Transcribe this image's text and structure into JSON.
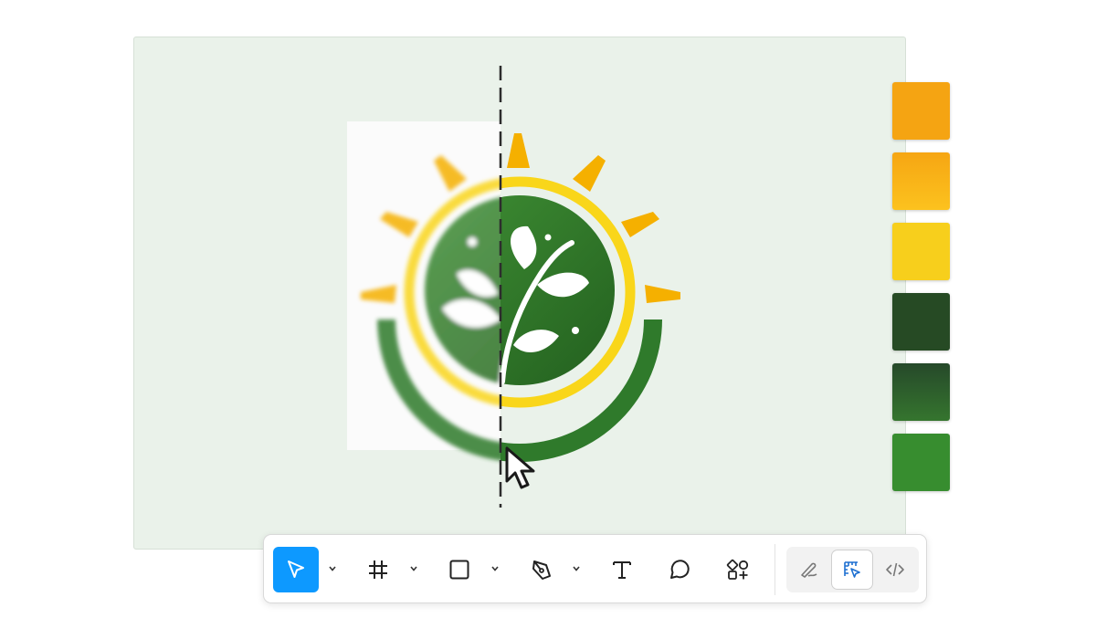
{
  "palette": {
    "swatches": [
      {
        "name": "orange",
        "color": "#f5a412"
      },
      {
        "name": "amber-gradient",
        "color": "#fbb81a"
      },
      {
        "name": "yellow",
        "color": "#f7cf1c"
      },
      {
        "name": "dark-green",
        "color": "#264a24"
      },
      {
        "name": "green-gradient",
        "color": "#2f6b2b"
      },
      {
        "name": "leaf-green",
        "color": "#378d2f"
      }
    ]
  },
  "toolbar": {
    "tools": [
      {
        "name": "move-tool",
        "icon": "cursor-arrow-icon",
        "active": true,
        "has_menu": true
      },
      {
        "name": "frame-tool",
        "icon": "frame-hash-icon",
        "active": false,
        "has_menu": true
      },
      {
        "name": "shape-tool",
        "icon": "rectangle-icon",
        "active": false,
        "has_menu": true
      },
      {
        "name": "pen-tool",
        "icon": "pen-nib-icon",
        "active": false,
        "has_menu": true
      },
      {
        "name": "text-tool",
        "icon": "text-T-icon",
        "active": false,
        "has_menu": false
      },
      {
        "name": "comment-tool",
        "icon": "speech-bubble-icon",
        "active": false,
        "has_menu": false
      },
      {
        "name": "resources-tool",
        "icon": "shapes-plus-icon",
        "active": false,
        "has_menu": false
      }
    ],
    "modes": [
      {
        "name": "draw-mode",
        "icon": "pen-scribble-icon",
        "active": false
      },
      {
        "name": "design-mode",
        "icon": "design-ruler-cursor-icon",
        "active": true
      },
      {
        "name": "dev-mode",
        "icon": "code-brackets-icon",
        "active": false
      }
    ],
    "accent_color": "#0d99ff"
  },
  "artwork": {
    "description_icon": "sun-leaf-logo-icon",
    "comparison": "blurry-original-vs-vector-split"
  }
}
